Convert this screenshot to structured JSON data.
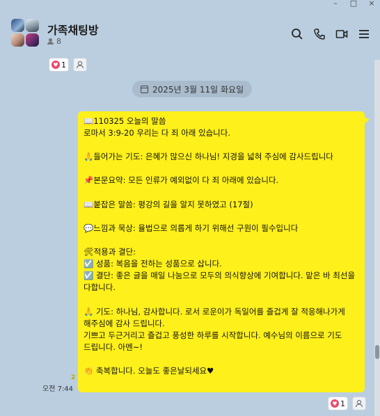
{
  "window": {
    "minimize": "–",
    "maximize": "□",
    "close": "×"
  },
  "header": {
    "title": "가족채팅방",
    "member_count": "8"
  },
  "top_reactions": {
    "heart_count": "1"
  },
  "date_divider": {
    "label": "2025년 3월 11일 화요일"
  },
  "message": {
    "time": "오전 7:44",
    "unread": "2",
    "lines": [
      "📖110325 오늘의 말씀",
      "로마서 3:9-20 우리는 다 죄 아래 있습니다.",
      "",
      "🙏들어가는 기도: 은혜가 많으신 하나님! 지경을 넓혀 주심에 감사드립니다",
      "",
      "📌본문요약: 모든 인류가 예외없이 다 죄 아래에 있습니다.",
      "",
      "📖붙잡은 말씀: 평강의 길을 알지 못하였고 (17절)",
      "",
      "💬느낌과 묵상: 율법으로 의롭게 하기 위해선 구원이 필수입니다",
      "",
      "🛠적용과 결단:",
      "☑️ 성품: 복음을 전하는 성품으로 삽니다.",
      "☑️ 결단: 좋은 글을 매일 나눔으로 모두의 의식향상에 기여합니다. 맡은 바 최선을 다합니다.",
      "",
      "🙏 기도: 하나님, 감사합니다. 로서 로운이가 독일어를 즐겁게 잘 적응해나가게 해주심에 감사 드립니다.",
      "기쁘고 두근거리고 즐겁고 풍성한 하루를 시작합니다. 예수님의 이름으로 기도 드립니다. 아멘~!",
      "",
      "👏 축복합니다. 오늘도 좋은날되세요♥"
    ]
  },
  "bottom_reactions": {
    "heart_count": "1"
  },
  "colors": {
    "background": "#bacee0",
    "bubble": "#fef01b",
    "heart": "#e94a6d"
  },
  "icons": [
    "search-icon",
    "phone-icon",
    "video-call-icon",
    "menu-icon",
    "heart-icon",
    "person-icon",
    "calendar-icon"
  ]
}
